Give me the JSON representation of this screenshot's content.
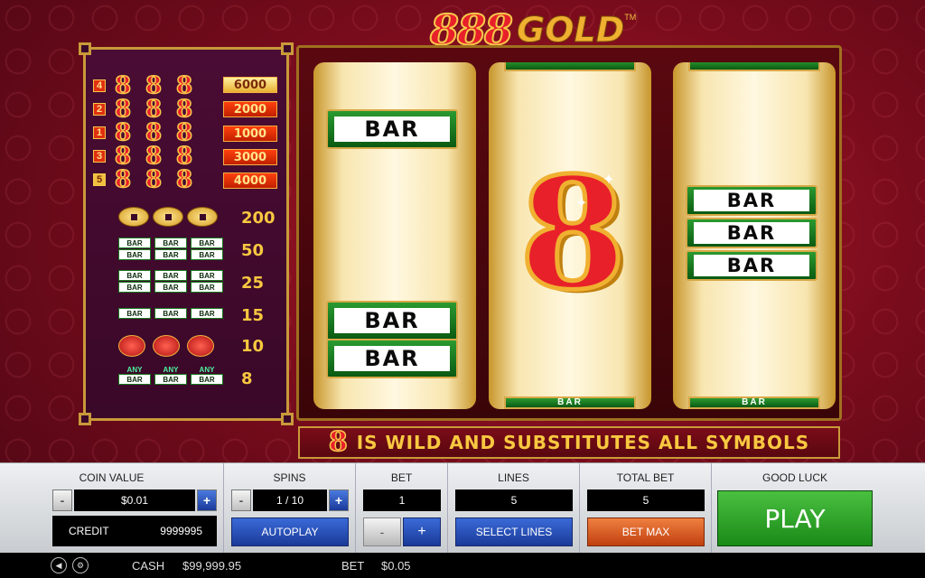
{
  "logo": {
    "number": "888",
    "word": "GOLD",
    "tm": "TM"
  },
  "paytable": {
    "eight_rows": [
      {
        "index": "4",
        "pay": "6000",
        "style": "gold"
      },
      {
        "index": "2",
        "pay": "2000",
        "style": "red"
      },
      {
        "index": "1",
        "pay": "1000",
        "style": "red"
      },
      {
        "index": "3",
        "pay": "3000",
        "style": "red"
      },
      {
        "index": "5",
        "pay": "4000",
        "style": "red"
      }
    ],
    "eight_symbol": "8",
    "symbol_rows": [
      {
        "symbol": "coins",
        "pay": "200"
      },
      {
        "symbol": "triple-bar",
        "pay": "50"
      },
      {
        "symbol": "double-bar",
        "pay": "25"
      },
      {
        "symbol": "single-bar",
        "pay": "15"
      },
      {
        "symbol": "lanterns",
        "pay": "10"
      },
      {
        "symbol": "any-bar",
        "pay": "8"
      }
    ],
    "bar_label": "BAR",
    "any_label": "ANY"
  },
  "reels": {
    "bar_label": "BAR",
    "center_symbol": "8"
  },
  "wild_banner": {
    "symbol": "8",
    "text": "IS WILD AND SUBSTITUTES ALL SYMBOLS"
  },
  "controls": {
    "coin_value": {
      "title": "COIN VALUE",
      "value": "$0.01",
      "minus": "-",
      "plus": "+"
    },
    "credit": {
      "label": "CREDIT",
      "value": "9999995"
    },
    "spins": {
      "title": "SPINS",
      "value": "1 / 10",
      "minus": "-",
      "plus": "+",
      "autoplay": "AUTOPLAY"
    },
    "bet": {
      "title": "BET",
      "value": "1",
      "minus": "-",
      "plus": "+"
    },
    "lines": {
      "title": "LINES",
      "value": "5",
      "select": "SELECT LINES"
    },
    "total_bet": {
      "title": "TOTAL BET",
      "value": "5",
      "bet_max": "BET MAX"
    },
    "play": {
      "title": "GOOD LUCK",
      "label": "PLAY"
    }
  },
  "status": {
    "cash_label": "CASH",
    "cash_value": "$99,999.95",
    "bet_label": "BET",
    "bet_value": "$0.05",
    "icons": [
      "back-icon",
      "settings-icon"
    ]
  },
  "colors": {
    "accent_red": "#e8202a",
    "gold": "#f0b030",
    "play_green": "#2a9a28",
    "button_blue": "#2a4ab8"
  }
}
